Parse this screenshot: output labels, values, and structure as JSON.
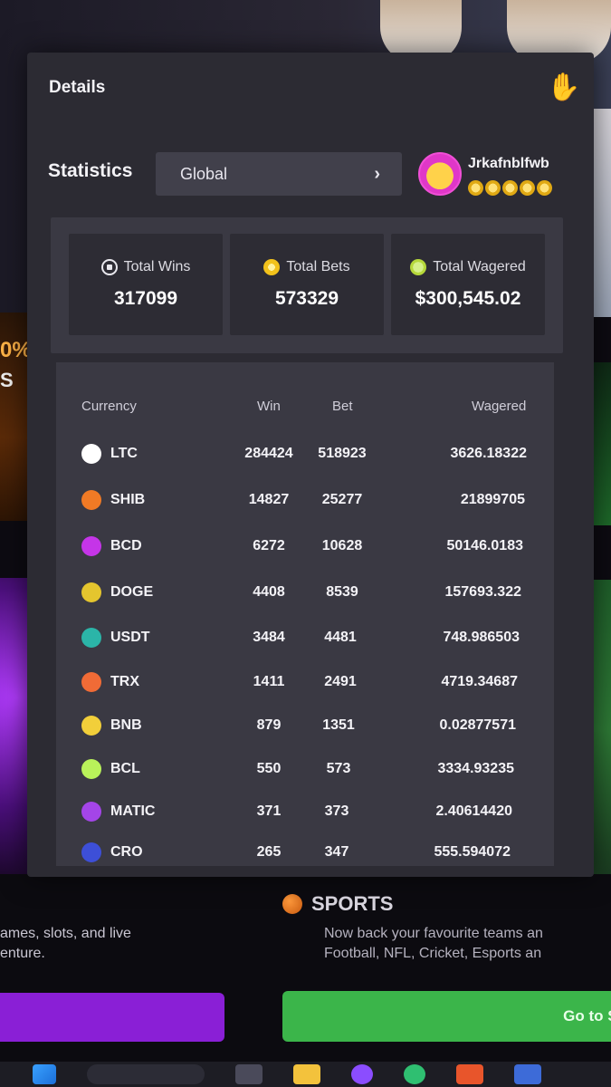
{
  "modal": {
    "title": "Details",
    "close_glyph": "✋",
    "statistics_label": "Statistics",
    "scope": {
      "value": "Global",
      "chevron": "›"
    },
    "user": {
      "name": "Jrkafnblfwb",
      "vip_stars": 5
    }
  },
  "summary": {
    "total_wins": {
      "label": "Total Wins",
      "value": "317099"
    },
    "total_bets": {
      "label": "Total Bets",
      "value": "573329"
    },
    "total_wagered": {
      "label": "Total Wagered",
      "value": "$300,545.02"
    }
  },
  "table": {
    "headers": {
      "currency": "Currency",
      "win": "Win",
      "bet": "Bet",
      "wagered": "Wagered"
    },
    "rows": [
      {
        "currency": "LTC",
        "win": "284424",
        "bet": "518923",
        "wagered": "3626.18322",
        "color": "#ffffff"
      },
      {
        "currency": "SHIB",
        "win": "14827",
        "bet": "25277",
        "wagered": "21899705",
        "color": "#f07a25"
      },
      {
        "currency": "BCD",
        "win": "6272",
        "bet": "10628",
        "wagered": "50146.0183",
        "color": "#c535e8"
      },
      {
        "currency": "DOGE",
        "win": "4408",
        "bet": "8539",
        "wagered": "157693.322",
        "color": "#e4c52e"
      },
      {
        "currency": "USDT",
        "win": "3484",
        "bet": "4481",
        "wagered": "748.986503",
        "color": "#2bb5a8"
      },
      {
        "currency": "TRX",
        "win": "1411",
        "bet": "2491",
        "wagered": "4719.34687",
        "color": "#f06b36"
      },
      {
        "currency": "BNB",
        "win": "879",
        "bet": "1351",
        "wagered": "0.02877571",
        "color": "#f2cf3a"
      },
      {
        "currency": "BCL",
        "win": "550",
        "bet": "573",
        "wagered": "3334.93235",
        "color": "#b9f25a"
      },
      {
        "currency": "MATIC",
        "win": "371",
        "bet": "373",
        "wagered": "2.40614420",
        "color": "#a445e8"
      },
      {
        "currency": "CRO",
        "win": "265",
        "bet": "347",
        "wagered": "555.594072",
        "color": "#3d4fd8"
      }
    ]
  },
  "background": {
    "left_promo_pct": "0%",
    "left_promo_letter": "S",
    "left_text_line1": "ames, slots, and live",
    "left_text_line2": "enture.",
    "sports_title": "SPORTS",
    "sports_desc_line1": "Now back your favourite teams an",
    "sports_desc_line2": "Football, NFL, Cricket, Esports an",
    "sports_button": "Go to Sp"
  },
  "colors": {
    "modal_bg": "#2c2b33",
    "panel_bg": "#3a3943",
    "card_bg": "#2d2c34",
    "sports_green": "#3bb54a",
    "promo_purple": "#8a1fd6"
  }
}
